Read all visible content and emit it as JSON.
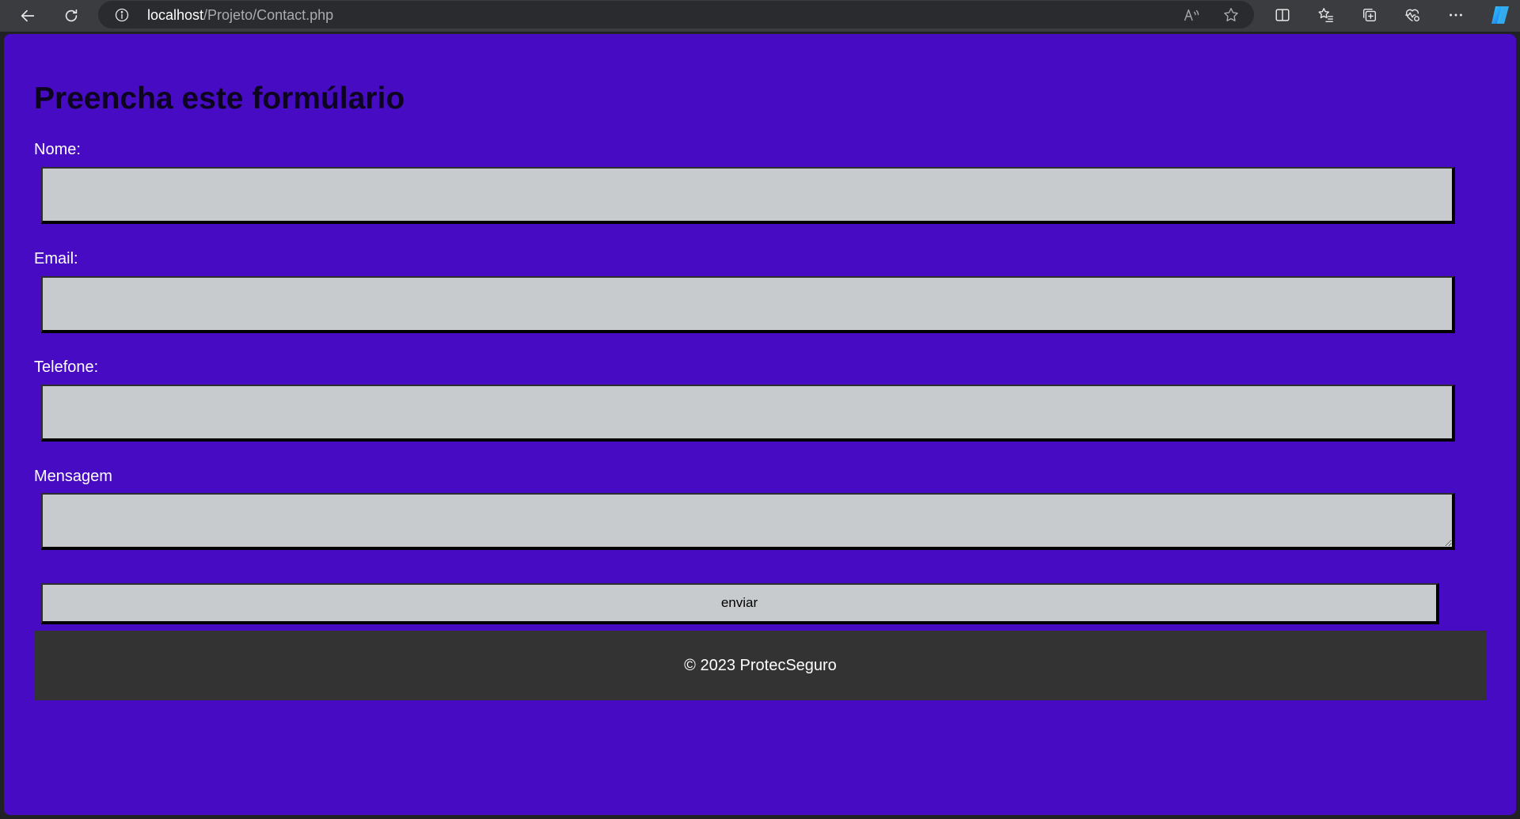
{
  "browser": {
    "url_host": "localhost",
    "url_path": "/Projeto/Contact.php"
  },
  "page": {
    "title": "Preencha este formúlario",
    "fields": [
      {
        "label": "Nome:",
        "value": "",
        "placeholder": ""
      },
      {
        "label": "Email:",
        "value": "",
        "placeholder": ""
      },
      {
        "label": "Telefone:",
        "value": "",
        "placeholder": ""
      },
      {
        "label": "Mensagem",
        "value": "",
        "placeholder": ""
      }
    ],
    "submit_label": "enviar",
    "footer_text": "© 2023 ProtecSeguro"
  },
  "colors": {
    "page_background": "#470bc3",
    "input_background": "#c7cbcd",
    "footer_background": "#333333",
    "title_color": "#0c0420"
  },
  "icons": {
    "toolbar": [
      "back-icon",
      "refresh-icon",
      "info-icon",
      "read-aloud-icon",
      "favorite-star-icon",
      "split-screen-icon",
      "favorites-icon",
      "collections-icon",
      "browser-essentials-icon",
      "more-icon",
      "copilot-icon"
    ]
  }
}
